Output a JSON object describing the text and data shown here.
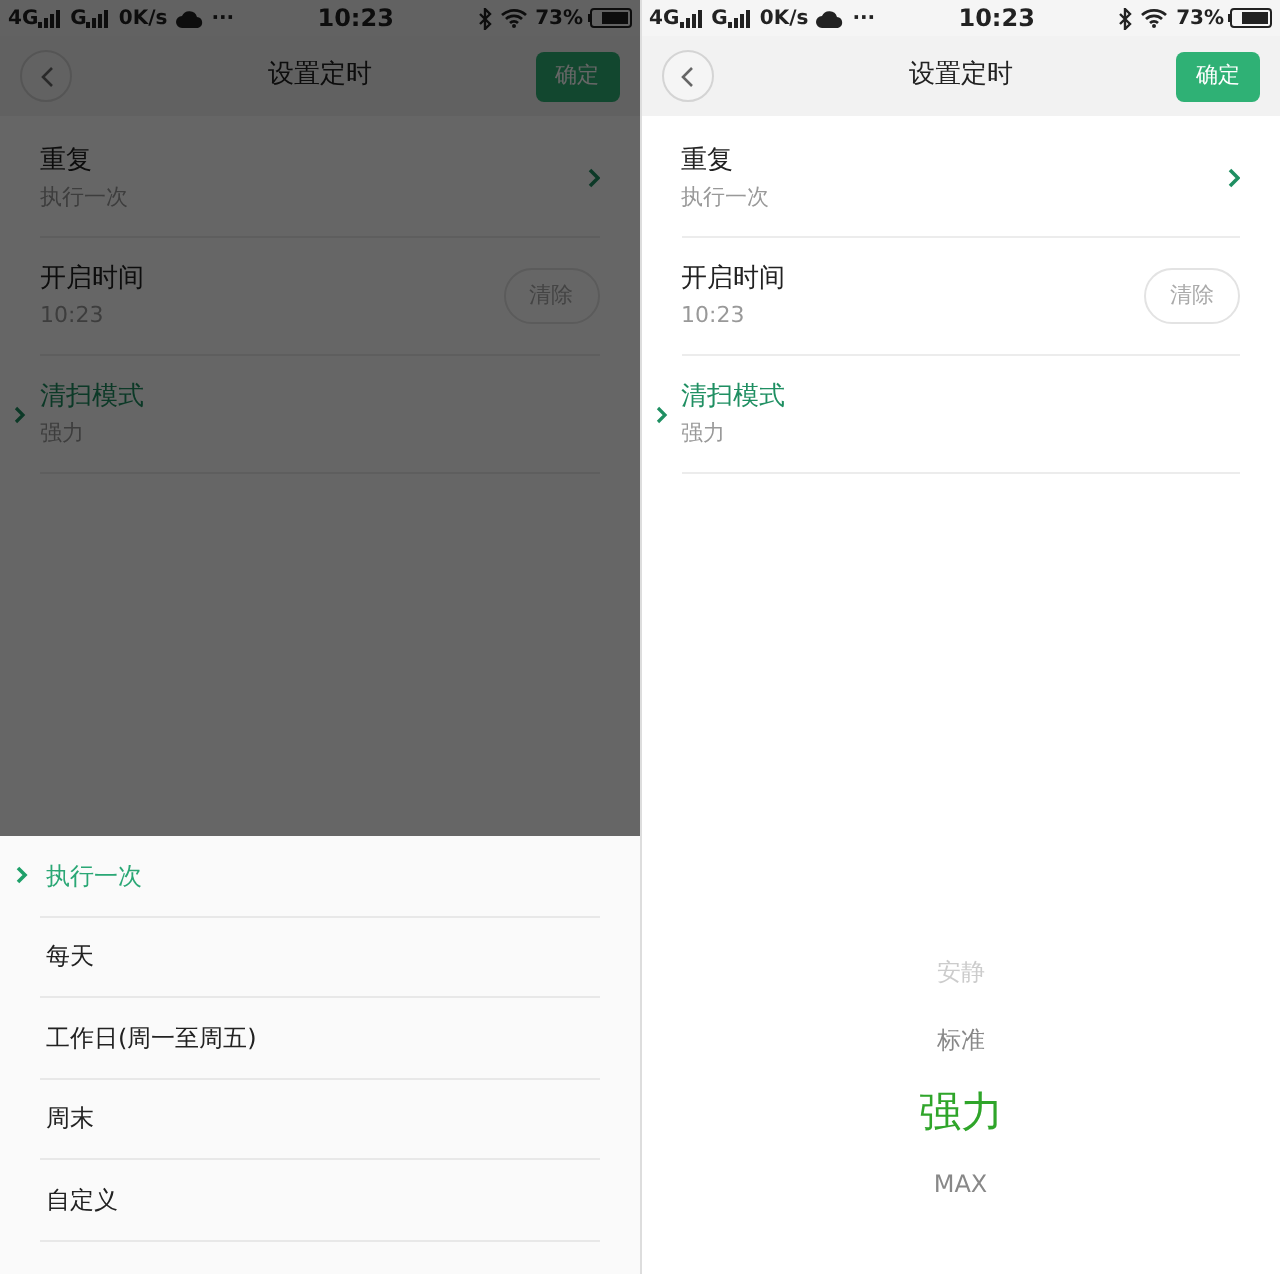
{
  "screens": [
    {
      "dimmed": true,
      "status_bar": {
        "network": "4G",
        "network2": "G",
        "speed": "0K/s",
        "more": "···",
        "time": "10:23",
        "battery": "73%"
      },
      "header": {
        "title": "设置定时",
        "confirm": "确定"
      },
      "rows": [
        {
          "kind": "nav",
          "title": "重复",
          "subtitle": "执行一次",
          "active": false
        },
        {
          "kind": "clear",
          "title": "开启时间",
          "subtitle": "10:23",
          "action": "清除",
          "active": false
        },
        {
          "kind": "plain",
          "title": "清扫模式",
          "subtitle": "强力",
          "active": true
        }
      ],
      "sheet": {
        "options": [
          {
            "label": "执行一次",
            "selected": true
          },
          {
            "label": "每天",
            "selected": false
          },
          {
            "label": "工作日(周一至周五)",
            "selected": false
          },
          {
            "label": "周末",
            "selected": false
          },
          {
            "label": "自定义",
            "selected": false
          }
        ]
      }
    },
    {
      "dimmed": false,
      "status_bar": {
        "network": "4G",
        "network2": "G",
        "speed": "0K/s",
        "more": "···",
        "time": "10:23",
        "battery": "73%"
      },
      "header": {
        "title": "设置定时",
        "confirm": "确定"
      },
      "rows": [
        {
          "kind": "nav",
          "title": "重复",
          "subtitle": "执行一次",
          "active": false
        },
        {
          "kind": "clear",
          "title": "开启时间",
          "subtitle": "10:23",
          "action": "清除",
          "active": false
        },
        {
          "kind": "plain",
          "title": "清扫模式",
          "subtitle": "强力",
          "active": true
        }
      ],
      "picker": {
        "options": [
          {
            "label": "安静",
            "selected": false
          },
          {
            "label": "标准",
            "selected": false
          },
          {
            "label": "强力",
            "selected": true
          },
          {
            "label": "MAX",
            "selected": false
          }
        ]
      }
    }
  ]
}
